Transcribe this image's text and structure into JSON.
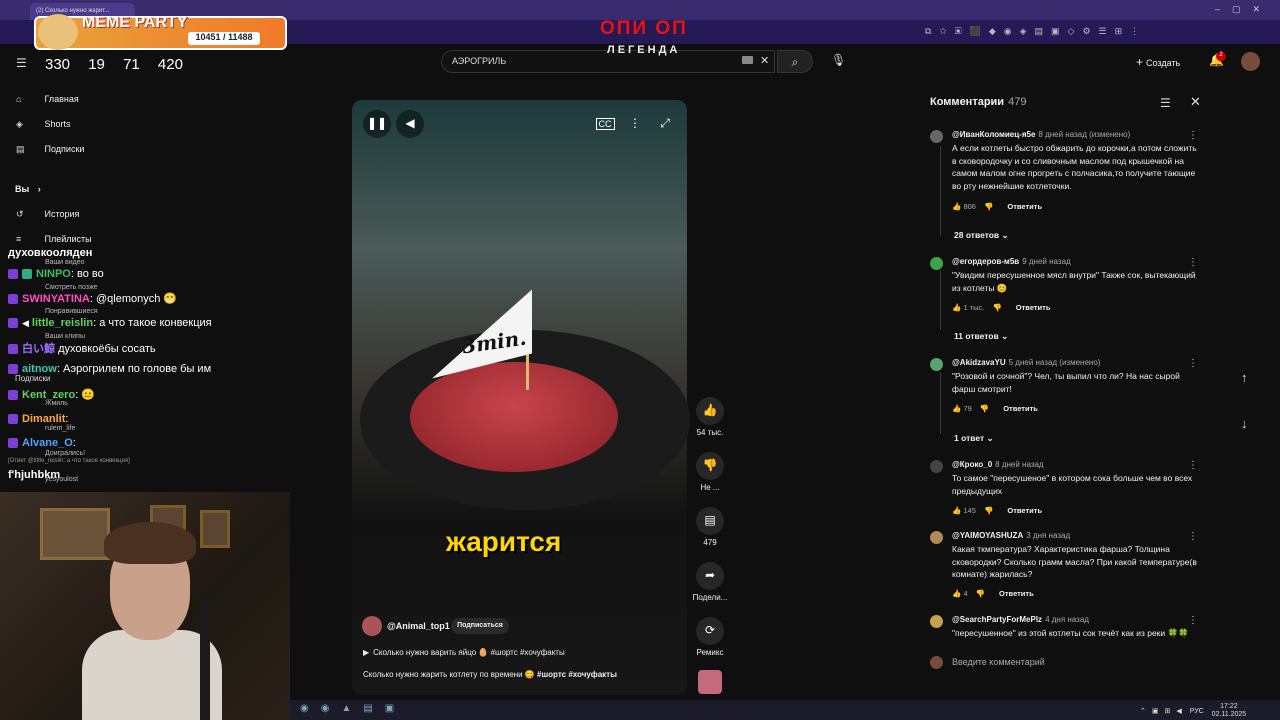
{
  "browser": {
    "tab_title": "(2) Сколько нужно жарит..."
  },
  "overlay": {
    "title": "ОПИ ОП",
    "subtitle": "ЛЕГЕНДА",
    "party_title": "MEME PARTY",
    "party_count": "10451 / 11488",
    "stats": [
      "330",
      "19",
      "71",
      "420"
    ]
  },
  "youtube": {
    "search_value": "АЭРОГРИЛЬ",
    "create_label": "Создать",
    "notification_badge": "2"
  },
  "sidebar": {
    "items": [
      {
        "label": "Главная",
        "icon": "home-icon"
      },
      {
        "label": "Shorts",
        "icon": "shorts-icon"
      },
      {
        "label": "Подписки",
        "icon": "subscriptions-icon"
      }
    ],
    "you_label": "Вы",
    "you_items": [
      {
        "label": "История",
        "icon": "history-icon"
      },
      {
        "label": "Плейлисты",
        "icon": "playlist-icon"
      }
    ]
  },
  "chat": {
    "lines": [
      {
        "nick": "духовкооляден",
        "text": "",
        "color": "#ffffff"
      },
      {
        "nick": "NINPO",
        "text": "во во",
        "color": "#3fbf5f"
      },
      {
        "nick": "SWINYATINA",
        "text": "@qlemonych",
        "color": "#ff4fc7"
      },
      {
        "nick": "little_reislin",
        "text": "а что такое конвекция",
        "color": "#5fd35f"
      },
      {
        "nick": "白い鯨",
        "text": "духовкоёбы сосать",
        "color": "#9f6fff"
      },
      {
        "nick": "aitnow",
        "text": "Аэрогрилем по голове бы им",
        "color": "#3fc9b0"
      },
      {
        "nick": "Kent_zero",
        "text": "",
        "color": "#5fd35f"
      },
      {
        "nick": "Dimanlit",
        "text": "",
        "color": "#ffa640"
      },
      {
        "nick": "Alvane_O",
        "text": "",
        "color": "#4fa3ff"
      },
      {
        "nick": "f'hjuhbkm",
        "text": "",
        "color": "#ffffff"
      }
    ],
    "sidebar_ghosts": [
      "Ваши видео",
      "Смотреть позже",
      "Понравившиеся",
      "Ваши клипы",
      "Подписки",
      "Жмиль",
      "rulem_life",
      "Доигрались!",
      "yesyoulost"
    ],
    "reply_note": "[Ответ @little_reislin: а что такое конвекция]"
  },
  "video": {
    "flag_text": "3min.",
    "caption": "жарится",
    "channel": "@Animal_top1",
    "subscribe_label": "Подписаться",
    "related": "Сколько нужно варить яйцо 🥚 #шортс #хочуфакты",
    "description": "Сколько нужно жарить котлету по времени 😋",
    "hashtags": "#шортс #хочуфакты"
  },
  "actions": [
    {
      "label": "54 тыс.",
      "icon": "like-icon"
    },
    {
      "label": "Не ...",
      "icon": "dislike-icon"
    },
    {
      "label": "479",
      "icon": "comments-icon"
    },
    {
      "label": "Подели...",
      "icon": "share-icon"
    },
    {
      "label": "Ремикс",
      "icon": "remix-icon"
    }
  ],
  "comments": {
    "title": "Комментарии",
    "count": "479",
    "input_placeholder": "Введите комментарий",
    "items": [
      {
        "author": "@ИванКоломиец-я5е",
        "when": "8 дней назад (изменено)",
        "text": "А если котлеты быстро обжарить до корочки,а потом сложить в сковородочку и со сливочным маслом под крышечкой на самом малом огне прогреть с полчасика,то получите тающие во рту нежнейшие котлеточки.",
        "likes": "806",
        "reply": "Ответить",
        "replies": "28 ответов",
        "av_color": "#555555"
      },
      {
        "author": "@егордеров-м5в",
        "when": "9 дней назад",
        "text": "\"Увидим пересушенное мясл внутри\" Также сок, вытекающий из котлеты 😊",
        "likes": "1 тыс.",
        "reply": "Ответить",
        "replies": "11 ответов",
        "av_color": "#3fa34d"
      },
      {
        "author": "@AkidzavaYU",
        "when": "5 дней назад (изменено)",
        "text": "\"Розовой и сочной\"? Чел, ты выпил что ли? На нас сырой фарш смотрит!",
        "likes": "79",
        "reply": "Ответить",
        "replies": "1 ответ",
        "av_color": "#5aa36a"
      },
      {
        "author": "@Кроко_0",
        "when": "8 дней назад",
        "text": "То самое \"пересушеное\" в котором сока больше чем во всех предыдущих",
        "likes": "145",
        "reply": "Ответить",
        "replies": "",
        "av_color": "#444444"
      },
      {
        "author": "@YAIMOYASHUZA",
        "when": "3 дня назад",
        "text": "Какая ткмпература? Характеристика фарша? Толщина сковородки? Сколько грамм масла? При какой температуре(в комнате) жарилась?",
        "likes": "4",
        "reply": "Ответить",
        "replies": "",
        "av_color": "#b08a5a"
      },
      {
        "author": "@SearchPartyForMePlz",
        "when": "4 дня назад",
        "text": "\"пересушенное\" из этой котлеты сок течёт как из реки 🍀🍀",
        "likes": "",
        "reply": "",
        "replies": "",
        "av_color": "#c9a050"
      }
    ]
  },
  "taskbar": {
    "lang": "РУС",
    "time": "17:22",
    "date": "02.11.2025"
  }
}
